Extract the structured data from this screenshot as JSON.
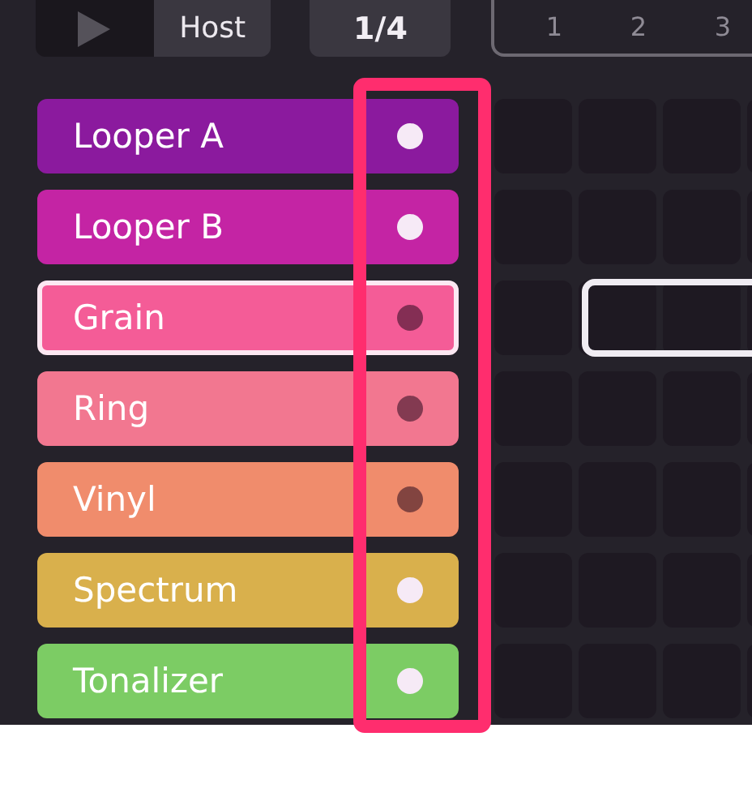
{
  "transport": {
    "sync_label": "Host",
    "playing": false
  },
  "page_button": {
    "label": "1/4"
  },
  "scene_numbers": [
    "1",
    "2",
    "3"
  ],
  "tracks": [
    {
      "name": "Looper A",
      "color": "#8b1a9e",
      "lit": true,
      "selected": false,
      "slots": [
        {
          "selected": false
        },
        {
          "selected": false
        },
        {
          "selected": false
        },
        {
          "selected": false
        }
      ]
    },
    {
      "name": "Looper B",
      "color": "#c424a4",
      "lit": true,
      "selected": false,
      "slots": [
        {
          "selected": false
        },
        {
          "selected": false
        },
        {
          "selected": false
        },
        {
          "selected": false
        }
      ]
    },
    {
      "name": "Grain",
      "color": "#f45c97",
      "lit": false,
      "selected": true,
      "slots": [
        {
          "selected": false
        },
        {
          "selected": true
        },
        {
          "selected": true
        },
        {
          "selected": true
        }
      ]
    },
    {
      "name": "Ring",
      "color": "#f27790",
      "lit": false,
      "selected": false,
      "slots": [
        {
          "selected": false
        },
        {
          "selected": false
        },
        {
          "selected": false
        },
        {
          "selected": false
        }
      ]
    },
    {
      "name": "Vinyl",
      "color": "#f08c6c",
      "lit": false,
      "selected": false,
      "slots": [
        {
          "selected": false
        },
        {
          "selected": false
        },
        {
          "selected": false
        },
        {
          "selected": false
        }
      ]
    },
    {
      "name": "Spectrum",
      "color": "#d9b04c",
      "lit": true,
      "selected": false,
      "slots": [
        {
          "selected": false
        },
        {
          "selected": false
        },
        {
          "selected": false
        },
        {
          "selected": false
        }
      ]
    },
    {
      "name": "Tonalizer",
      "color": "#7ccc64",
      "lit": true,
      "selected": false,
      "slots": [
        {
          "selected": false
        },
        {
          "selected": false
        },
        {
          "selected": false
        },
        {
          "selected": false
        }
      ]
    }
  ]
}
